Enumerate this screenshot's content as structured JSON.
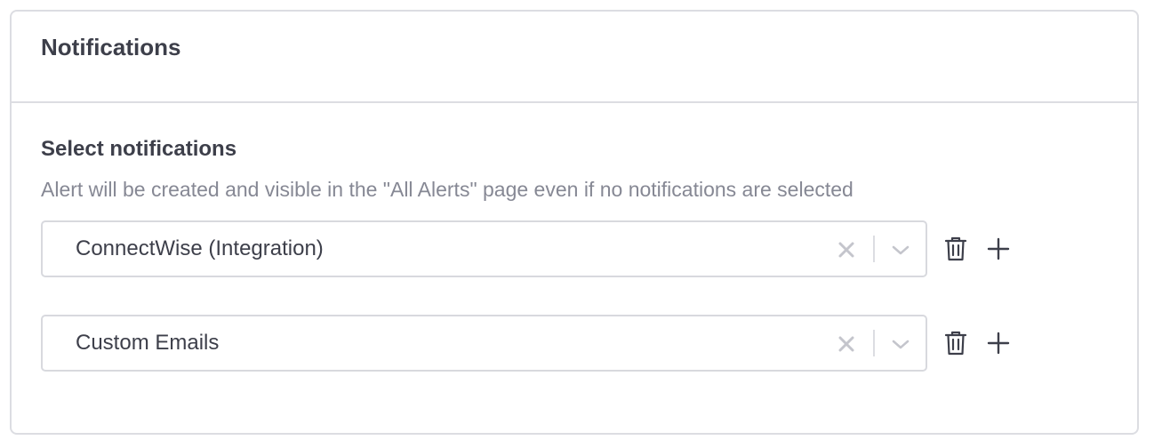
{
  "card": {
    "title": "Notifications"
  },
  "section": {
    "title": "Select notifications",
    "description": "Alert will be created and visible in the \"All Alerts\" page even if no notifications are selected"
  },
  "notifications": [
    {
      "value": "ConnectWise (Integration)",
      "clear_icon": "close-icon",
      "dropdown_icon": "chevron-down-icon",
      "delete_icon": "trash-icon",
      "add_icon": "plus-icon"
    },
    {
      "value": "Custom Emails",
      "clear_icon": "close-icon",
      "dropdown_icon": "chevron-down-icon",
      "delete_icon": "trash-icon",
      "add_icon": "plus-icon"
    }
  ],
  "colors": {
    "text_primary": "#3d3f4a",
    "text_secondary": "#868894",
    "border": "#dcdde2",
    "icon_muted": "#c4c5cc"
  }
}
